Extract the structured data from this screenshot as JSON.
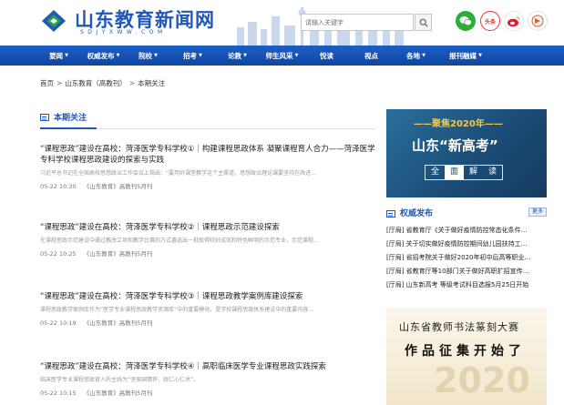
{
  "header": {
    "site_name": "山东教育新闻网",
    "site_domain": "SDJYXWW.COM",
    "search_placeholder": "请输入关键字",
    "toutiao_label": "头条"
  },
  "nav": [
    {
      "label": "要闻",
      "caret": true
    },
    {
      "label": "权威发布",
      "caret": true
    },
    {
      "label": "院校",
      "caret": true
    },
    {
      "label": "招考",
      "caret": true
    },
    {
      "label": "论教",
      "caret": true
    },
    {
      "label": "师生风采",
      "caret": true
    },
    {
      "label": "悦读",
      "caret": false
    },
    {
      "label": "视点",
      "caret": false
    },
    {
      "label": "各地",
      "caret": true
    },
    {
      "label": "报刊融媒",
      "caret": true
    }
  ],
  "breadcrumb": {
    "home": "首页",
    "sep1": ">",
    "channel": "山东教育（高教刊）",
    "sep2": ">",
    "current": "本期关注"
  },
  "section": {
    "title": "本期关注"
  },
  "articles": [
    {
      "title": "“课程思政”建设在高校：菏泽医学专科学校①｜构建课程思政体系 凝聚课程育人合力——菏泽医学专科学校课程思政建设的探索与实践",
      "summary": "习近平总书记在全国高校思想政治工作会议上指出：“要用好课堂教学这个主渠道，思想政治理论课要坚持在改进…",
      "date": "05-22 10:30",
      "source": "《山东教育》高教刊5月刊"
    },
    {
      "title": "“课程思政”建设在高校：菏泽医学专科学校②｜课程思政示范建设探索",
      "summary": "在课程思政示范建设中通过教改立项和教学比赛的方式遴选出一批取得较好成效和特色鲜明的示范专业，示范课程…",
      "date": "05-22 10:25",
      "source": "《山东教育》高教刊5月刊"
    },
    {
      "title": "“课程思政”建设在高校：菏泽医学专科学校③｜课程思政教学案例库建设探索",
      "summary": "课程思政教学案例库作为“医学专业课程思政教学资源库”中的重要模块，是学校课程思政体系建设中的重要内容…",
      "date": "05-22 10:19",
      "source": "《山东教育》高教刊5月刊"
    },
    {
      "title": "“课程思政”建设在高校：菏泽医学专科学校④｜高职临床医学专业课程思政实践探索",
      "summary": "临床医学专业课程思政育人的主线为“坚家国情怀、践仁心仁术”。",
      "date": "05-22 10:15",
      "source": "《山东教育》高教刊5月刊"
    }
  ],
  "banner": {
    "tag": "——聚焦2020年——",
    "main": "山东“新高考”",
    "box_chars": [
      "全",
      "面",
      "解",
      "读"
    ]
  },
  "sidebar": {
    "title": "权威发布",
    "more_label": "更多",
    "items": [
      "[厅局] 省教育厅《关于做好疫情防控常态化条件…",
      "[厅局] 关于切实做好疫情防控期间幼儿园扶持工…",
      "[厅局] 省招考院关于做好2020年初中后高等职业…",
      "[厅局] 省教育厅等10部门关于做好高职扩招宣传…",
      "[厅局] 山东新高考 等级考试科目选报5月25日开始"
    ]
  },
  "promo": {
    "line1": "山东省教师书法篆刻大赛",
    "line2": "作品征集开始了",
    "year": "2020"
  },
  "colors": {
    "brand": "#1f58b8",
    "nav": "#1552b0"
  }
}
